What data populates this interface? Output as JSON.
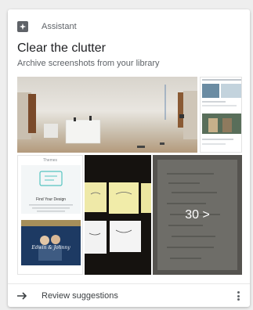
{
  "header": {
    "label": "Assistant",
    "icon": "assistant-sparkle-icon"
  },
  "card": {
    "title": "Clear the clutter",
    "subtitle": "Archive screenshots from your library"
  },
  "tiles": {
    "themes_screen": {
      "tab_title": "Themes",
      "heading": "Find Your Design"
    },
    "wedding_screen": {
      "names": "Edwin & Johnny"
    },
    "more_count": "30 >"
  },
  "footer": {
    "label": "Review suggestions",
    "arrow_icon": "arrow-right-icon",
    "menu_icon": "more-vert-icon"
  },
  "colors": {
    "text_primary": "#202124",
    "text_secondary": "#5f6368",
    "card_bg": "#ffffff",
    "page_bg": "#eeeeee"
  }
}
